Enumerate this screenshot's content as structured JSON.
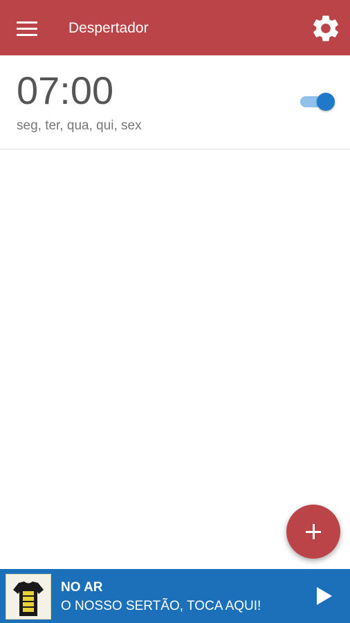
{
  "header": {
    "title": "Despertador",
    "menu_icon": "hamburger-menu-icon",
    "settings_icon": "gear-icon",
    "color": "#bb4448"
  },
  "alarm": {
    "time": "07:00",
    "days": "seg, ter, qua, qui, sex",
    "enabled": true
  },
  "fab": {
    "icon": "plus-icon",
    "color": "#bb4448"
  },
  "player": {
    "label": "NO AR",
    "song": "O NOSSO SERTÃO, TOCA AQUI!",
    "play_icon": "play-icon",
    "color": "#1b70b9"
  }
}
